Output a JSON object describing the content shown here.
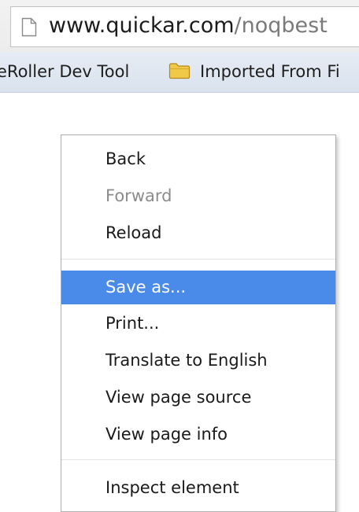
{
  "browser": {
    "url_host": "www.quickar.com",
    "url_path": "/noqbest",
    "page_icon": "page-icon",
    "bookmarks": [
      {
        "label": "eRoller Dev Tool",
        "icon": "none"
      },
      {
        "label": "Imported From Fi",
        "icon": "folder-icon"
      }
    ]
  },
  "context_menu": {
    "items": [
      {
        "label": "Back",
        "state": "enabled"
      },
      {
        "label": "Forward",
        "state": "disabled"
      },
      {
        "label": "Reload",
        "state": "enabled"
      },
      {
        "label": "Save as...",
        "state": "highlighted"
      },
      {
        "label": "Print...",
        "state": "enabled"
      },
      {
        "label": "Translate to English",
        "state": "enabled"
      },
      {
        "label": "View page source",
        "state": "enabled"
      },
      {
        "label": "View page info",
        "state": "enabled"
      },
      {
        "label": "Inspect element",
        "state": "enabled"
      }
    ],
    "highlight_color": "#4a8ae8",
    "disabled_text_color": "#8c8c8c"
  }
}
